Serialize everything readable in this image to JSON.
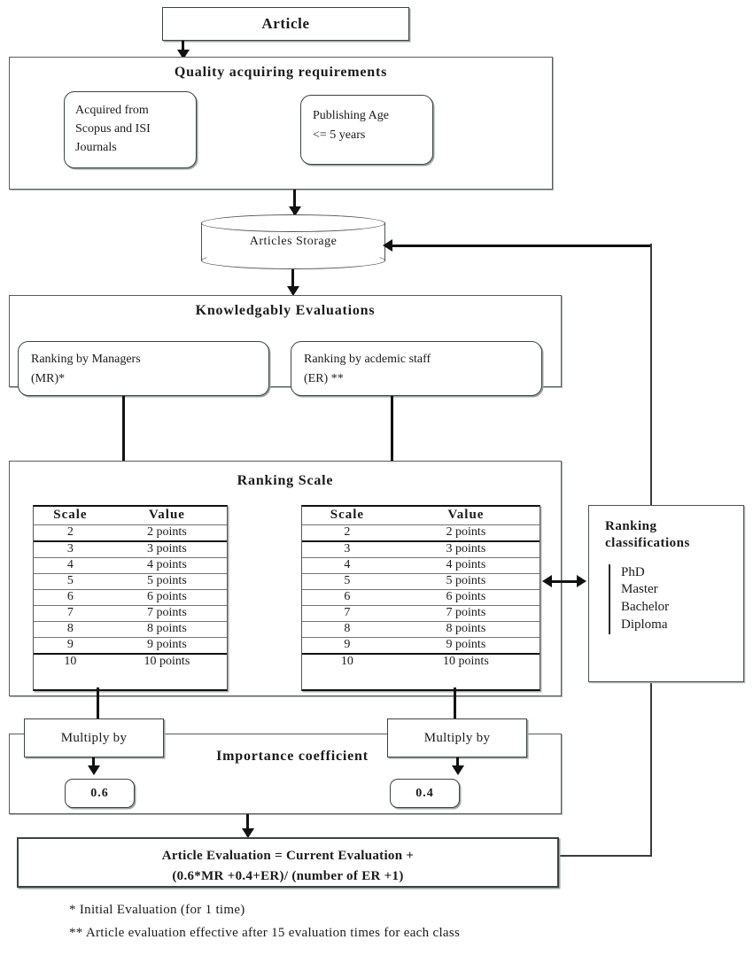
{
  "diagram": {
    "title": "Article evaluation flowchart",
    "article_box": {
      "label": "Article"
    },
    "quality": {
      "heading": "Quality acquiring requirements",
      "cards": [
        {
          "label": "Acquired from\nScopus and ISI\nJournals"
        },
        {
          "label": "Publishing Age\n<= 5 years"
        }
      ]
    },
    "storage": {
      "label": "Articles Storage"
    },
    "evaluations": {
      "heading": "Knowledgably Evaluations",
      "cards": [
        {
          "label": "Ranking by Managers\n(MR)*"
        },
        {
          "label": "Ranking by acdemic staff\n(ER) **"
        }
      ]
    },
    "ranking_scale": {
      "heading": "Ranking Scale",
      "columns": [
        "Scale",
        "Value"
      ],
      "rows": [
        [
          "2",
          "2 points"
        ],
        [
          "3",
          "3 points"
        ],
        [
          "4",
          "4 points"
        ],
        [
          "5",
          "5 points"
        ],
        [
          "6",
          "6 points"
        ],
        [
          "7",
          "7 points"
        ],
        [
          "8",
          "8 points"
        ],
        [
          "9",
          "9 points"
        ],
        [
          "10",
          "10 points"
        ]
      ]
    },
    "ranking_classifications": {
      "title": "Ranking\nclassifications",
      "items": [
        "PhD",
        "Master",
        "Bachelor",
        "Diploma"
      ]
    },
    "importance": {
      "heading": "Importance coefficient",
      "left_op": "Multiply by",
      "right_op": "Multiply by",
      "left_value": "0.6",
      "right_value": "0.4"
    },
    "result": {
      "line1": "Article Evaluation = Current Evaluation +",
      "line2": "(0.6*MR +0.4+ER)/ (number of ER +1)"
    },
    "footnotes": [
      "* Initial Evaluation (for 1 time)",
      "** Article evaluation effective after 15 evaluation times for each class"
    ]
  },
  "colors": {
    "ink": "#1a1a1a",
    "line": "#111111",
    "border": "#3a4442",
    "shadow": "#9aa3a1"
  }
}
